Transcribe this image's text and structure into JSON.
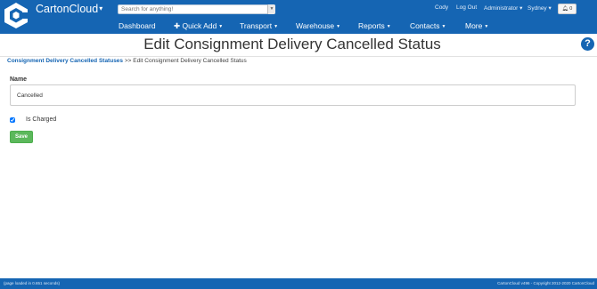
{
  "header": {
    "brand": "CartonCloud",
    "search_placeholder": "Search for anything!",
    "user_name": "Cody",
    "logout": "Log Out",
    "role": "Administrator",
    "location": "Sydney",
    "notifications_count": "0"
  },
  "nav": {
    "items": [
      "Dashboard",
      "Quick Add",
      "Transport",
      "Warehouse",
      "Reports",
      "Contacts",
      "More"
    ]
  },
  "page": {
    "title": "Edit Consignment Delivery Cancelled Status",
    "breadcrumb_link": "Consignment Delivery Cancelled Statuses",
    "breadcrumb_sep": ">>",
    "breadcrumb_current": "Edit Consignment Delivery Cancelled Status"
  },
  "form": {
    "name_label": "Name",
    "name_value": "Cancelled",
    "is_charged_label": "Is Charged",
    "is_charged_checked": true,
    "save_label": "Save"
  },
  "footer": {
    "load_time": "(page loaded in 0.651 seconds)",
    "copyright": "CartonCloud v496 - Copyright 2012-2020 CartonCloud"
  },
  "colors": {
    "primary": "#1565b3",
    "success": "#5cb85c"
  }
}
